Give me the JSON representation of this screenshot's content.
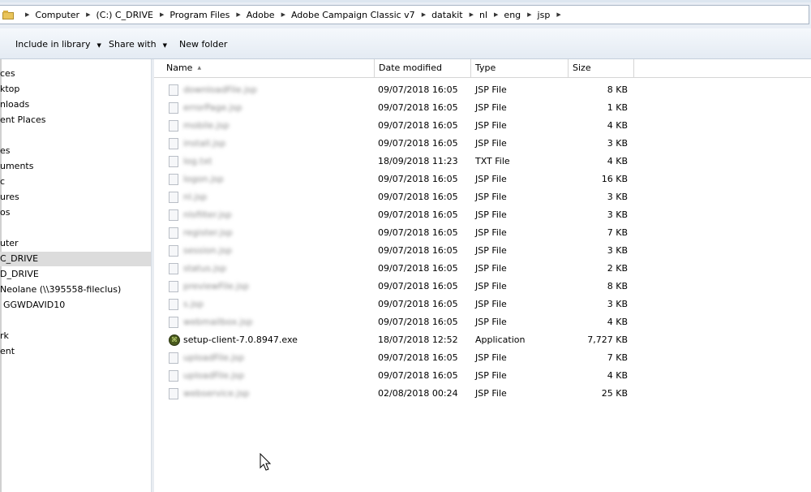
{
  "address_bar": {
    "crumbs": [
      "Computer",
      "(C:) C_DRIVE",
      "Program Files",
      "Adobe",
      "Adobe Campaign Classic v7",
      "datakit",
      "nl",
      "eng",
      "jsp"
    ]
  },
  "toolbar": {
    "include_label": "Include in library",
    "share_label": "Share with",
    "new_folder_label": "New folder"
  },
  "nav": {
    "items": [
      "ces",
      "ktop",
      "nloads",
      "ent Places",
      "es",
      "uments",
      "c",
      "ures",
      "os",
      "uter",
      "C_DRIVE",
      "D_DRIVE",
      "Neolane (\\\\395558-fileclus)",
      "GGWDAVID10",
      "rk",
      "ent"
    ],
    "selected_index": 10
  },
  "columns": {
    "name": "Name",
    "date": "Date modified",
    "type": "Type",
    "size": "Size"
  },
  "files": [
    {
      "name": "downloadFile.jsp",
      "date": "09/07/2018 16:05",
      "type": "JSP File",
      "size": "8 KB",
      "blurred": true,
      "icon": "file-icon"
    },
    {
      "name": "errorPage.jsp",
      "date": "09/07/2018 16:05",
      "type": "JSP File",
      "size": "1 KB",
      "blurred": true,
      "icon": "file-icon"
    },
    {
      "name": "mobile.jsp",
      "date": "09/07/2018 16:05",
      "type": "JSP File",
      "size": "4 KB",
      "blurred": true,
      "icon": "file-icon"
    },
    {
      "name": "install.jsp",
      "date": "09/07/2018 16:05",
      "type": "JSP File",
      "size": "3 KB",
      "blurred": true,
      "icon": "file-icon"
    },
    {
      "name": "log.txt",
      "date": "18/09/2018 11:23",
      "type": "TXT File",
      "size": "4 KB",
      "blurred": true,
      "icon": "file-icon"
    },
    {
      "name": "logon.jsp",
      "date": "09/07/2018 16:05",
      "type": "JSP File",
      "size": "16 KB",
      "blurred": true,
      "icon": "file-icon"
    },
    {
      "name": "nl.jsp",
      "date": "09/07/2018 16:05",
      "type": "JSP File",
      "size": "3 KB",
      "blurred": true,
      "icon": "file-icon"
    },
    {
      "name": "nlsfilter.jsp",
      "date": "09/07/2018 16:05",
      "type": "JSP File",
      "size": "3 KB",
      "blurred": true,
      "icon": "file-icon"
    },
    {
      "name": "register.jsp",
      "date": "09/07/2018 16:05",
      "type": "JSP File",
      "size": "7 KB",
      "blurred": true,
      "icon": "file-icon"
    },
    {
      "name": "session.jsp",
      "date": "09/07/2018 16:05",
      "type": "JSP File",
      "size": "3 KB",
      "blurred": true,
      "icon": "file-icon"
    },
    {
      "name": "status.jsp",
      "date": "09/07/2018 16:05",
      "type": "JSP File",
      "size": "2 KB",
      "blurred": true,
      "icon": "file-icon"
    },
    {
      "name": "previewFile.jsp",
      "date": "09/07/2018 16:05",
      "type": "JSP File",
      "size": "8 KB",
      "blurred": true,
      "icon": "file-icon"
    },
    {
      "name": "s.jsp",
      "date": "09/07/2018 16:05",
      "type": "JSP File",
      "size": "3 KB",
      "blurred": true,
      "icon": "file-icon"
    },
    {
      "name": "webmailbox.jsp",
      "date": "09/07/2018 16:05",
      "type": "JSP File",
      "size": "4 KB",
      "blurred": true,
      "icon": "file-icon"
    },
    {
      "name": "setup-client-7.0.8947.exe",
      "date": "18/07/2018 12:52",
      "type": "Application",
      "size": "7,727 KB",
      "blurred": false,
      "icon": "app-icon"
    },
    {
      "name": "uploadFile.jsp",
      "date": "09/07/2018 16:05",
      "type": "JSP File",
      "size": "7 KB",
      "blurred": true,
      "icon": "file-icon"
    },
    {
      "name": "uploadFile.jsp",
      "date": "09/07/2018 16:05",
      "type": "JSP File",
      "size": "4 KB",
      "blurred": true,
      "icon": "file-icon"
    },
    {
      "name": "webservice.jsp",
      "date": "02/08/2018 00:24",
      "type": "JSP File",
      "size": "25 KB",
      "blurred": true,
      "icon": "file-icon"
    }
  ],
  "colors": {
    "address_bg": "#e9eef5",
    "toolbar_bg": "#e4ebf3",
    "selected_nav_bg": "#dcdcdc",
    "app_icon": "#4a5a1f"
  }
}
